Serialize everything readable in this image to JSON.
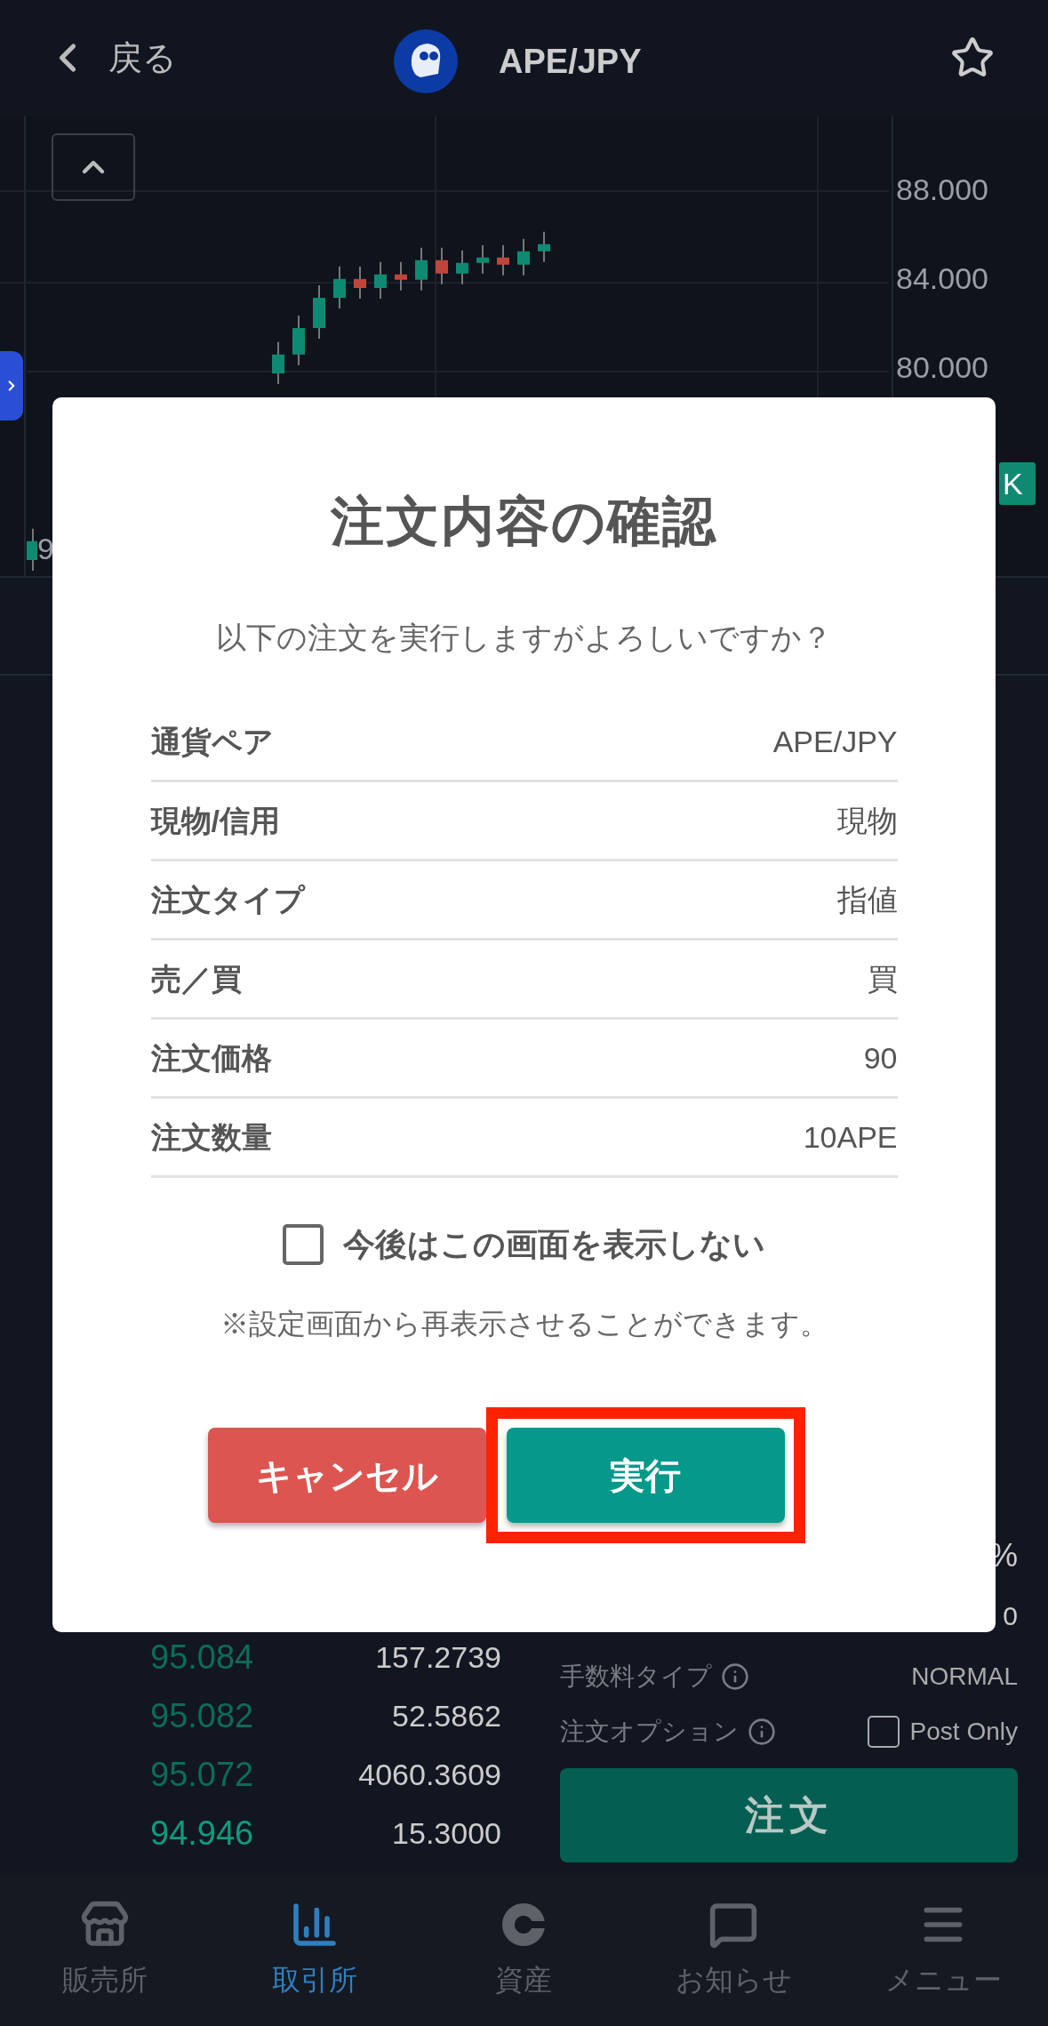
{
  "header": {
    "back_label": "戻る",
    "pair": "APE/JPY",
    "favorite": false
  },
  "chart": {
    "y_labels": [
      "88.000",
      "84.000",
      "80.000"
    ],
    "badge": "K",
    "edge_label": "9"
  },
  "order_book": [
    {
      "price": "95.084",
      "amount": "157.2739"
    },
    {
      "price": "95.082",
      "amount": "52.5862"
    },
    {
      "price": "95.072",
      "amount": "4060.3609"
    },
    {
      "price": "94.946",
      "amount": "15.3000"
    }
  ],
  "form": {
    "percent": "%",
    "amount_tail": "0",
    "fee_type_label": "手数料タイプ",
    "fee_type": "NORMAL",
    "option_label": "注文オプション",
    "post_only": {
      "label": "Post Only",
      "checked": false
    },
    "submit": "注文"
  },
  "dialog": {
    "title": "注文内容の確認",
    "message": "以下の注文を実行しますがよろしいですか？",
    "rows": [
      {
        "label": "通貨ペア",
        "value": "APE/JPY"
      },
      {
        "label": "現物/信用",
        "value": "現物"
      },
      {
        "label": "注文タイプ",
        "value": "指値"
      },
      {
        "label": "売／買",
        "value": "買"
      },
      {
        "label": "注文価格",
        "value": "90"
      },
      {
        "label": "注文数量",
        "value": "10APE"
      }
    ],
    "dont_show": {
      "label": "今後はこの画面を表示しない",
      "checked": false
    },
    "note": "※設定画面から再表示させることができます。",
    "buttons": [
      {
        "label": "キャンセル",
        "kind": "cancel",
        "highlighted": false
      },
      {
        "label": "実行",
        "kind": "confirm",
        "highlighted": true
      }
    ]
  },
  "nav": [
    {
      "label": "販売所",
      "kind": "store",
      "selected": false
    },
    {
      "label": "取引所",
      "kind": "chart",
      "selected": true
    },
    {
      "label": "資産",
      "kind": "assets",
      "selected": false
    },
    {
      "label": "お知らせ",
      "kind": "news",
      "selected": false
    },
    {
      "label": "メニュー",
      "kind": "menu",
      "selected": false
    }
  ]
}
